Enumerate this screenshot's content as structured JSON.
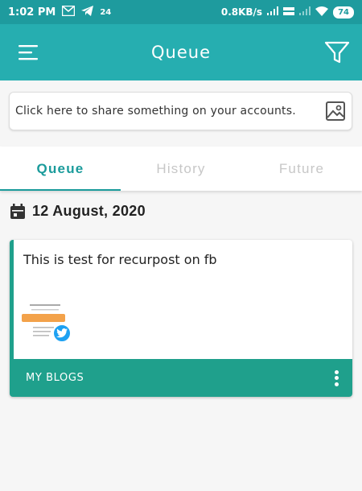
{
  "status_bar": {
    "time": "1:02 PM",
    "notif_count": "24",
    "speed": "0.8KB/s",
    "battery": "74"
  },
  "app_bar": {
    "title": "Queue",
    "menu_icon": "hamburger-menu-icon",
    "filter_icon": "filter-icon"
  },
  "share": {
    "placeholder": "Click here to share something on your accounts.",
    "icon": "image-icon"
  },
  "tabs": [
    {
      "label": "Queue",
      "active": true
    },
    {
      "label": "History",
      "active": false
    },
    {
      "label": "Future",
      "active": false
    }
  ],
  "date_header": {
    "icon": "calendar-icon",
    "date": "12 August, 2020"
  },
  "post_card": {
    "text": "This is test for recurpost on fb",
    "social_icon": "twitter-icon",
    "group": "MY BLOGS",
    "more_icon": "more-vertical-icon"
  },
  "colors": {
    "status_bar": "#1e9b9e",
    "app_bar": "#26aeb0",
    "tab_accent": "#1a9b9b",
    "card_footer": "#1fa08c",
    "twitter": "#1da1f2"
  }
}
